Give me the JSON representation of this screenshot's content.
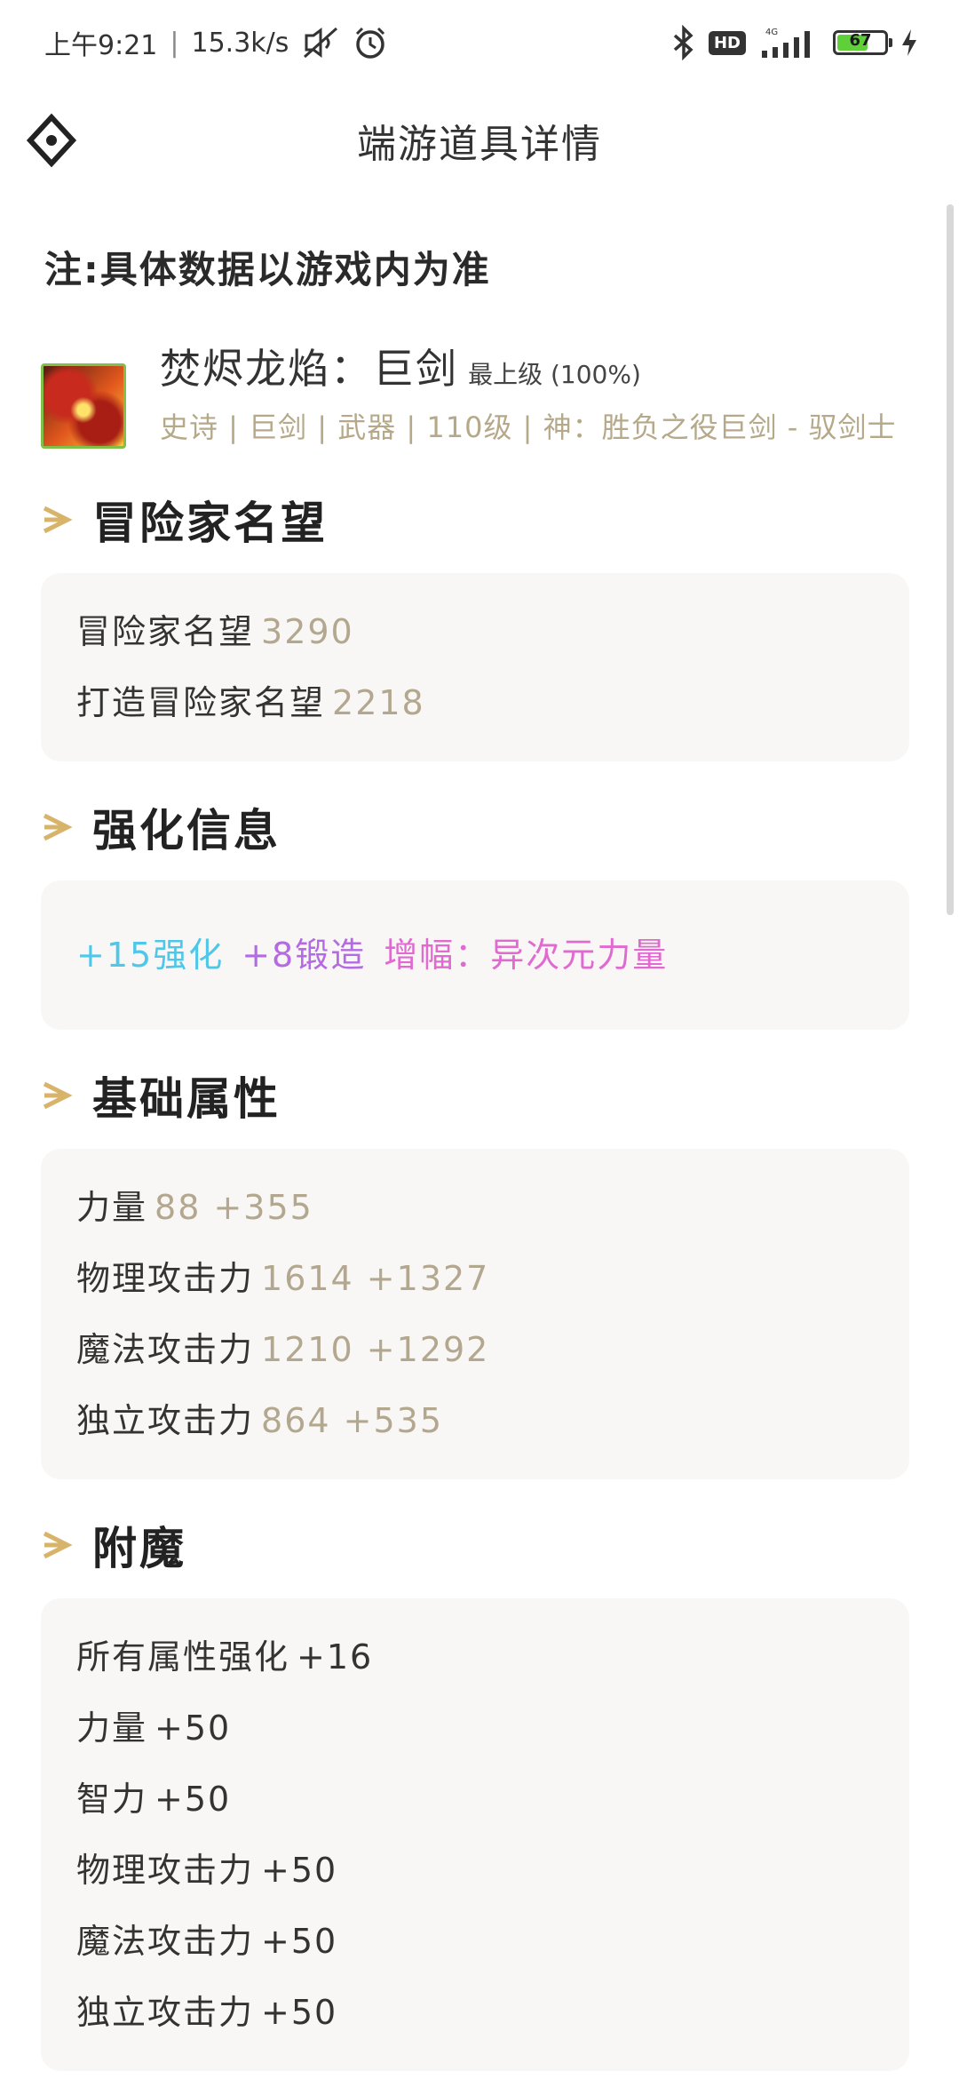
{
  "status_bar": {
    "time": "上午9:21",
    "speed": "15.3k/s",
    "network": "4G",
    "hd_label": "HD",
    "battery": "67",
    "battery_level": 0.67
  },
  "header": {
    "title": "端游道具详情"
  },
  "note": "注:具体数据以游戏内为准",
  "item": {
    "name": "焚烬龙焰：巨剑",
    "grade": "最上级 (100%)",
    "meta": "史诗 | 巨剑 | 武器 | 110级 | 神：胜负之役巨剑 - 驭剑士"
  },
  "sections": {
    "reputation": {
      "title": "冒险家名望",
      "rows": [
        {
          "label": "冒险家名望",
          "value": "3290"
        },
        {
          "label": "打造冒险家名望",
          "value": "2218"
        }
      ]
    },
    "enhance": {
      "title": "强化信息",
      "reinforce": "+15强化",
      "forge": "+8锻造",
      "amplify": "增幅：异次元力量"
    },
    "base": {
      "title": "基础属性",
      "rows": [
        {
          "label": "力量",
          "value": "88 +355"
        },
        {
          "label": "物理攻击力",
          "value": "1614 +1327"
        },
        {
          "label": "魔法攻击力",
          "value": "1210 +1292"
        },
        {
          "label": "独立攻击力",
          "value": "864 +535"
        }
      ]
    },
    "enchant": {
      "title": "附魔",
      "rows": [
        {
          "label": "所有属性强化",
          "value": "+16"
        },
        {
          "label": "力量",
          "value": "+50"
        },
        {
          "label": "智力",
          "value": "+50"
        },
        {
          "label": "物理攻击力",
          "value": "+50"
        },
        {
          "label": "魔法攻击力",
          "value": "+50"
        },
        {
          "label": "独立攻击力",
          "value": "+50"
        }
      ]
    }
  },
  "colors": {
    "accent_arrow": "#d8b46a",
    "value_muted": "#b3a88f",
    "reinforce": "#4fc7e8",
    "forge": "#b46ae0",
    "amplify": "#e06ad0",
    "card_bg": "#f8f7f5"
  },
  "icons": [
    "bluetooth-icon",
    "signal-icon",
    "battery-icon",
    "charging-icon",
    "mute-icon",
    "alarm-icon",
    "back-icon",
    "section-arrow-icon",
    "item-icon"
  ]
}
